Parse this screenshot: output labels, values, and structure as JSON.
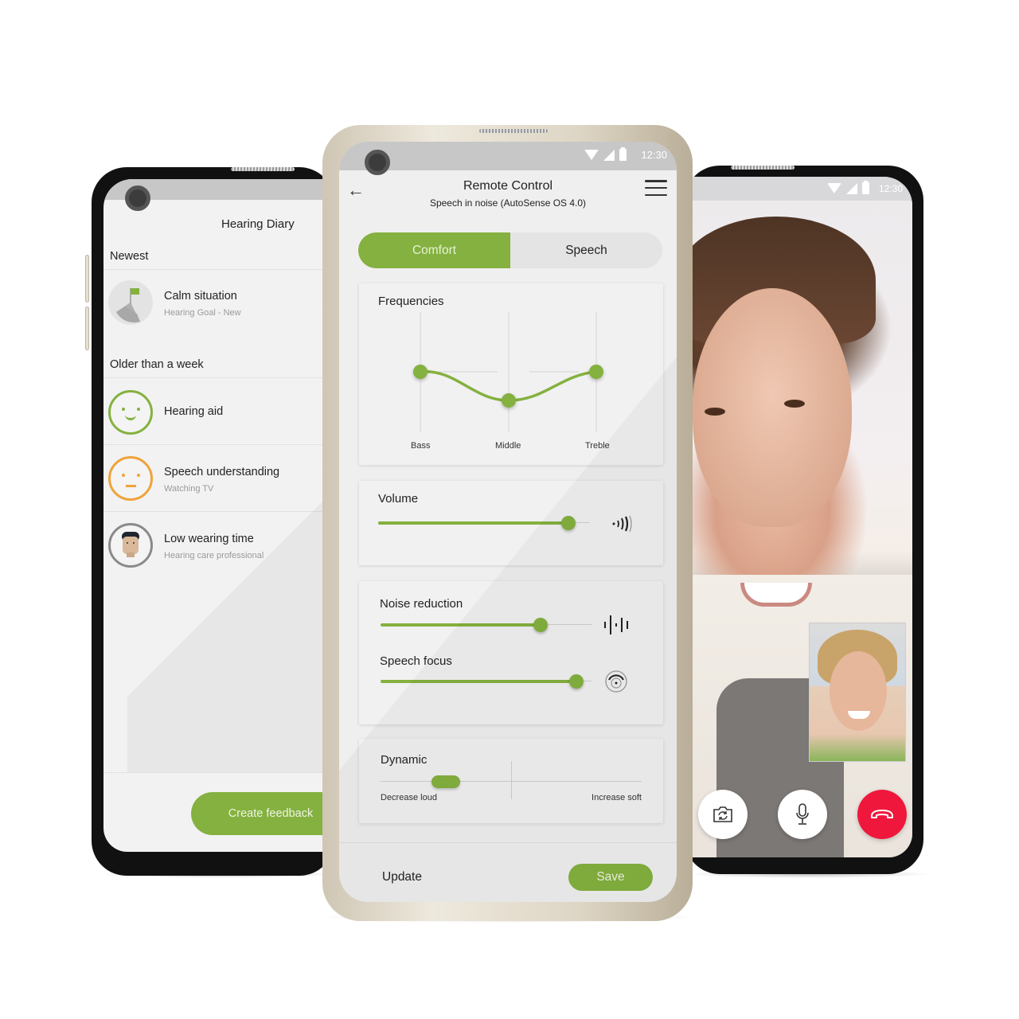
{
  "colors": {
    "accent": "#84b13f",
    "warning": "#f0a33a",
    "end_call": "#f0173c",
    "neutral_avatar": "#8a8a8a"
  },
  "status_bar": {
    "time": "12:30",
    "icons": [
      "wifi-icon",
      "cellular-signal-icon",
      "battery-icon"
    ]
  },
  "left_phone": {
    "title": "Hearing Diary",
    "sections": [
      {
        "label": "Newest",
        "items": [
          {
            "title": "Calm situation",
            "subtitle": "Hearing Goal - New",
            "icon": "goal-flag-icon"
          }
        ]
      },
      {
        "label": "Older than a week",
        "items": [
          {
            "title": "Hearing aid",
            "subtitle": "",
            "icon": "happy-face-icon"
          },
          {
            "title": "Speech understanding",
            "subtitle": "Watching TV",
            "icon": "neutral-face-icon"
          },
          {
            "title": "Low wearing time",
            "subtitle": "Hearing care professional",
            "icon": "professional-avatar"
          }
        ]
      }
    ],
    "create_button": "Create feedback"
  },
  "center_phone": {
    "title": "Remote Control",
    "subtitle": "Speech in noise (AutoSense OS 4.0)",
    "tabs": [
      {
        "label": "Comfort",
        "active": true
      },
      {
        "label": "Speech",
        "active": false
      }
    ],
    "frequencies": {
      "label": "Frequencies",
      "bands": [
        {
          "label": "Bass",
          "level": 0.5
        },
        {
          "label": "Middle",
          "level": 0.26
        },
        {
          "label": "Treble",
          "level": 0.5
        }
      ]
    },
    "volume": {
      "label": "Volume",
      "value": 0.9,
      "icon": "sound-waves-icon"
    },
    "noise_reduction": {
      "label": "Noise reduction",
      "value": 0.76,
      "icon": "noise-waveform-icon"
    },
    "speech_focus": {
      "label": "Speech focus",
      "value": 0.93,
      "icon": "speech-focus-icon"
    },
    "dynamic": {
      "label": "Dynamic",
      "left_label": "Decrease loud",
      "right_label": "Increase soft",
      "value": -0.5
    },
    "footer": {
      "update_label": "Update",
      "save_button": "Save"
    }
  },
  "right_phone": {
    "call_controls": [
      {
        "name": "switch-camera",
        "icon": "camera-switch-icon"
      },
      {
        "name": "mute",
        "icon": "microphone-icon"
      },
      {
        "name": "end-call",
        "icon": "end-call-icon"
      }
    ]
  }
}
